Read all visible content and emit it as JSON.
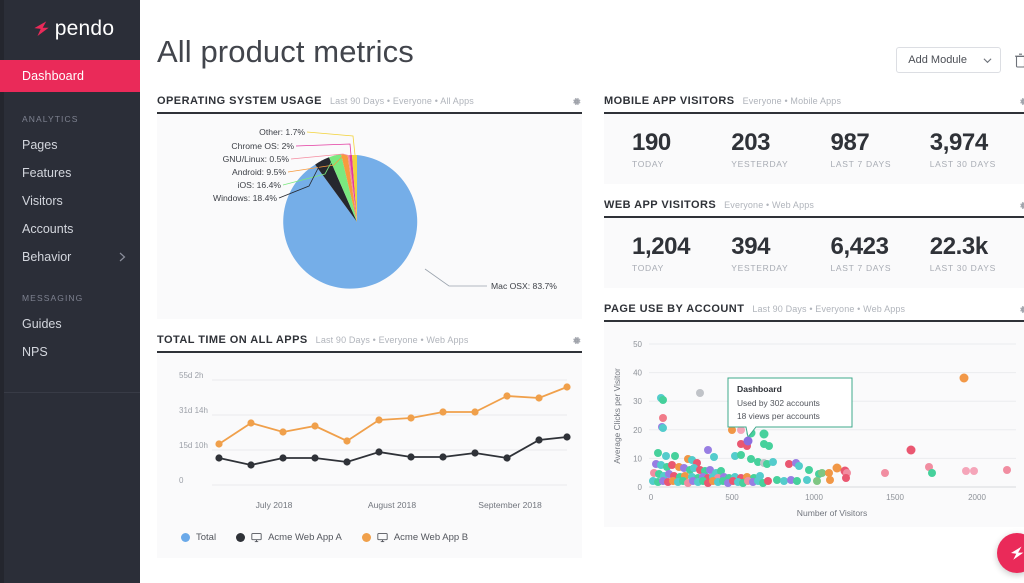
{
  "brand": {
    "name": "pendo",
    "logo_icon": "pendo-arrow-icon"
  },
  "sidebar": {
    "active_item": "Dashboard",
    "groups": [
      {
        "title": "ANALYTICS",
        "items": [
          {
            "label": "Pages",
            "chevron": false
          },
          {
            "label": "Features",
            "chevron": false
          },
          {
            "label": "Visitors",
            "chevron": false
          },
          {
            "label": "Accounts",
            "chevron": false
          },
          {
            "label": "Behavior",
            "chevron": true,
            "chevron_icon": "chevron-right-icon"
          }
        ]
      },
      {
        "title": "MESSAGING",
        "items": [
          {
            "label": "Guides",
            "chevron": false
          },
          {
            "label": "NPS",
            "chevron": false
          }
        ]
      }
    ]
  },
  "header": {
    "title": "All product metrics",
    "add_module_label": "Add Module",
    "add_module_icon": "chevron-down-icon",
    "delete_icon": "trash-icon"
  },
  "fab": {
    "icon": "pendo-arrow-icon",
    "color": "#ea2a59"
  },
  "modules": {
    "os_usage": {
      "title": "OPERATING SYSTEM USAGE",
      "subtitle": "Last 90 Days • Everyone • All Apps",
      "settings_icon": "gear-icon"
    },
    "mobile_visitors": {
      "title": "MOBILE APP VISITORS",
      "subtitle": "Everyone • Mobile Apps",
      "settings_icon": "gear-icon",
      "stats": [
        {
          "value": "190",
          "label": "TODAY"
        },
        {
          "value": "203",
          "label": "YESTERDAY"
        },
        {
          "value": "987",
          "label": "LAST 7 DAYS"
        },
        {
          "value": "3,974",
          "label": "LAST 30 DAYS"
        }
      ]
    },
    "web_visitors": {
      "title": "WEB APP VISITORS",
      "subtitle": "Everyone • Web Apps",
      "settings_icon": "gear-icon",
      "stats": [
        {
          "value": "1,204",
          "label": "TODAY"
        },
        {
          "value": "394",
          "label": "YESTERDAY"
        },
        {
          "value": "6,423",
          "label": "LAST 7 DAYS"
        },
        {
          "value": "22.3k",
          "label": "LAST 30 DAYS"
        }
      ]
    },
    "total_time": {
      "title": "TOTAL TIME ON ALL APPS",
      "subtitle": "Last 90 Days • Everyone • Web Apps",
      "settings_icon": "gear-icon",
      "legend": [
        {
          "label": "Total",
          "color": "#6aa9e9",
          "monitor": false
        },
        {
          "label": "Acme Web App A",
          "color": "#2f3238",
          "monitor": true,
          "monitor_icon": "monitor-icon"
        },
        {
          "label": "Acme Web App B",
          "color": "#f0a04b",
          "monitor": true,
          "monitor_icon": "monitor-icon"
        }
      ]
    },
    "page_use": {
      "title": "PAGE USE BY ACCOUNT",
      "subtitle": "Last 90 Days • Everyone • Web Apps",
      "settings_icon": "gear-icon",
      "tooltip": {
        "title": "Dashboard",
        "line1": "Used by 302 accounts",
        "line2": "18 views per accounts",
        "border_color": "#3fa98b"
      }
    }
  },
  "chart_data": [
    {
      "id": "os_usage_pie",
      "type": "pie",
      "title": "Operating System Usage",
      "legend": "labels-with-leader-lines",
      "slices": [
        {
          "label": "Mac OSX",
          "value": 83.7,
          "display": "Mac OSX: 83.7%",
          "color": "#75aee8"
        },
        {
          "label": "Windows",
          "value": 18.4,
          "display": "Windows: 18.4%",
          "color": "#26272e"
        },
        {
          "label": "iOS",
          "value": 16.4,
          "display": "iOS: 16.4%",
          "color": "#7ae87f"
        },
        {
          "label": "Android",
          "value": 9.5,
          "display": "Android: 9.5%",
          "color": "#f79b3e"
        },
        {
          "label": "GNU/Linux",
          "value": 0.5,
          "display": "GNU/Linux: 0.5%",
          "color": "#f58ca0"
        },
        {
          "label": "Chrome OS",
          "value": 2,
          "display": "Chrome OS: 2%",
          "color": "#e23aa0"
        },
        {
          "label": "Other",
          "value": 1.7,
          "display": "Other: 1.7%",
          "color": "#f2d23a"
        }
      ]
    },
    {
      "id": "total_time_line",
      "type": "line",
      "title": "Total Time on All Apps",
      "xlabel": "",
      "ylabel": "",
      "grid": true,
      "legend_position": "bottom",
      "y_ticks": [
        "0",
        "15d 10h",
        "31d 14h",
        "55d 2h"
      ],
      "y_tick_values": [
        0,
        15.42,
        31.58,
        55.08
      ],
      "ylim": [
        0,
        62
      ],
      "x_ticks": [
        "July 2018",
        "August 2018",
        "September 2018"
      ],
      "series": [
        {
          "name": "Acme Web App B",
          "color": "#f0a04b",
          "values": [
            16.5,
            27.5,
            23.5,
            26.0,
            18.0,
            29.5,
            30.5,
            33.0,
            33.0,
            40.0,
            39.5,
            44.5
          ]
        },
        {
          "name": "Acme Web App A",
          "color": "#2f3238",
          "values": [
            11.5,
            8.0,
            11.5,
            11.5,
            9.5,
            15.0,
            12.0,
            12.0,
            14.5,
            11.5,
            20.0,
            21.5
          ]
        },
        {
          "name": "Total",
          "color": "#6aa9e9",
          "values": []
        }
      ]
    },
    {
      "id": "page_use_scatter",
      "type": "scatter",
      "title": "Page Use by Account",
      "xlabel": "Number of Visitors",
      "ylabel": "Average Clicks per Visitor",
      "xlim": [
        0,
        2250
      ],
      "ylim": [
        0,
        52
      ],
      "x_ticks": [
        0,
        500,
        1000,
        1500,
        2000
      ],
      "y_ticks": [
        0,
        10,
        20,
        30,
        40,
        50
      ],
      "annotation": {
        "label": "Dashboard",
        "accounts": 302,
        "views_per_account": 18,
        "point": {
          "x": 840,
          "y": 14
        }
      },
      "points": [
        {
          "x": 60,
          "y": 31,
          "c": "#3ec6c6"
        },
        {
          "x": 70,
          "y": 30.5,
          "c": "#2ecc8f"
        },
        {
          "x": 300,
          "y": 33,
          "c": "#b9bcc2"
        },
        {
          "x": 75,
          "y": 24,
          "c": "#f06a7a"
        },
        {
          "x": 68,
          "y": 21,
          "c": "#8b6ee0"
        },
        {
          "x": 70,
          "y": 20.5,
          "c": "#3ec6c6"
        },
        {
          "x": 1920,
          "y": 38,
          "c": "#f08a2e"
        },
        {
          "x": 1590,
          "y": 13,
          "c": "#e8415e"
        },
        {
          "x": 1700,
          "y": 7,
          "c": "#f07f95"
        },
        {
          "x": 1720,
          "y": 5,
          "c": "#2ecc8f"
        },
        {
          "x": 1440,
          "y": 5,
          "c": "#f07f95"
        },
        {
          "x": 1930,
          "y": 5.5,
          "c": "#f59ab0"
        },
        {
          "x": 1980,
          "y": 5.5,
          "c": "#f59ab0"
        },
        {
          "x": 2180,
          "y": 6,
          "c": "#f07f95"
        },
        {
          "x": 500,
          "y": 20,
          "c": "#f08a2e"
        },
        {
          "x": 560,
          "y": 20,
          "c": "#f59ab0"
        },
        {
          "x": 620,
          "y": 19,
          "c": "#2ecc8f"
        },
        {
          "x": 700,
          "y": 18.5,
          "c": "#2ecc8f"
        },
        {
          "x": 560,
          "y": 15,
          "c": "#e8415e"
        },
        {
          "x": 600,
          "y": 14.5,
          "c": "#e8415e"
        },
        {
          "x": 700,
          "y": 15,
          "c": "#2ecc8f"
        },
        {
          "x": 730,
          "y": 14.5,
          "c": "#2ecc8f"
        },
        {
          "x": 350,
          "y": 13,
          "c": "#8b6ee0"
        },
        {
          "x": 390,
          "y": 10.5,
          "c": "#3ec6c6"
        },
        {
          "x": 520,
          "y": 11,
          "c": "#3ec6c6"
        },
        {
          "x": 560,
          "y": 11.5,
          "c": "#2ecc8f"
        },
        {
          "x": 620,
          "y": 10,
          "c": "#2ecc8f"
        },
        {
          "x": 660,
          "y": 9,
          "c": "#2ecc8f"
        },
        {
          "x": 700,
          "y": 8.5,
          "c": "#b9bcc2"
        },
        {
          "x": 720,
          "y": 8,
          "c": "#2ecc8f"
        },
        {
          "x": 760,
          "y": 9,
          "c": "#3ec6c6"
        },
        {
          "x": 860,
          "y": 8,
          "c": "#e8415e"
        },
        {
          "x": 900,
          "y": 8.5,
          "c": "#8b6ee0"
        },
        {
          "x": 920,
          "y": 7.5,
          "c": "#3ec6c6"
        },
        {
          "x": 980,
          "y": 6,
          "c": "#2ecc8f"
        },
        {
          "x": 1040,
          "y": 4.5,
          "c": "#2ecc8f"
        },
        {
          "x": 1060,
          "y": 5,
          "c": "#6fbf73"
        },
        {
          "x": 1100,
          "y": 5,
          "c": "#f08a2e"
        },
        {
          "x": 1150,
          "y": 6.5,
          "c": "#f08a2e"
        },
        {
          "x": 1200,
          "y": 5.5,
          "c": "#e8415e"
        },
        {
          "x": 1210,
          "y": 5,
          "c": "#f07f95"
        },
        {
          "x": 40,
          "y": 12,
          "c": "#2ecc8f"
        },
        {
          "x": 90,
          "y": 11,
          "c": "#3ec6c6"
        },
        {
          "x": 150,
          "y": 11,
          "c": "#2ecc8f"
        },
        {
          "x": 230,
          "y": 10,
          "c": "#f08a2e"
        },
        {
          "x": 250,
          "y": 9.5,
          "c": "#3ec6c6"
        },
        {
          "x": 280,
          "y": 8.5,
          "c": "#e8415e"
        },
        {
          "x": 30,
          "y": 8,
          "c": "#8b6ee0"
        },
        {
          "x": 60,
          "y": 7.5,
          "c": "#3ec6c6"
        },
        {
          "x": 100,
          "y": 7,
          "c": "#2ecc8f"
        },
        {
          "x": 130,
          "y": 7.5,
          "c": "#e8415e"
        },
        {
          "x": 170,
          "y": 7,
          "c": "#f08a2e"
        },
        {
          "x": 200,
          "y": 6.5,
          "c": "#8b6ee0"
        },
        {
          "x": 240,
          "y": 6,
          "c": "#2ecc8f"
        },
        {
          "x": 270,
          "y": 6.5,
          "c": "#3ec6c6"
        },
        {
          "x": 300,
          "y": 6,
          "c": "#e8415e"
        },
        {
          "x": 330,
          "y": 5.5,
          "c": "#2ecc8f"
        },
        {
          "x": 360,
          "y": 6,
          "c": "#8b6ee0"
        },
        {
          "x": 400,
          "y": 5,
          "c": "#3ec6c6"
        },
        {
          "x": 430,
          "y": 5.5,
          "c": "#2ecc8f"
        },
        {
          "x": 20,
          "y": 5,
          "c": "#f07f95"
        },
        {
          "x": 50,
          "y": 4.5,
          "c": "#2ecc8f"
        },
        {
          "x": 80,
          "y": 4,
          "c": "#3ec6c6"
        },
        {
          "x": 110,
          "y": 4.5,
          "c": "#8b6ee0"
        },
        {
          "x": 140,
          "y": 4,
          "c": "#e8415e"
        },
        {
          "x": 180,
          "y": 3.5,
          "c": "#2ecc8f"
        },
        {
          "x": 210,
          "y": 4,
          "c": "#f08a2e"
        },
        {
          "x": 250,
          "y": 3.5,
          "c": "#3ec6c6"
        },
        {
          "x": 290,
          "y": 3,
          "c": "#2ecc8f"
        },
        {
          "x": 320,
          "y": 3.5,
          "c": "#8b6ee0"
        },
        {
          "x": 350,
          "y": 3,
          "c": "#e8415e"
        },
        {
          "x": 380,
          "y": 3.5,
          "c": "#3ec6c6"
        },
        {
          "x": 410,
          "y": 3,
          "c": "#f07f95"
        },
        {
          "x": 450,
          "y": 3.5,
          "c": "#8b6ee0"
        },
        {
          "x": 480,
          "y": 3,
          "c": "#2ecc8f"
        },
        {
          "x": 520,
          "y": 3.5,
          "c": "#3ec6c6"
        },
        {
          "x": 560,
          "y": 3,
          "c": "#e8415e"
        },
        {
          "x": 600,
          "y": 3.5,
          "c": "#f08a2e"
        },
        {
          "x": 640,
          "y": 3,
          "c": "#2ecc8f"
        },
        {
          "x": 680,
          "y": 4,
          "c": "#3ec6c6"
        },
        {
          "x": 15,
          "y": 2,
          "c": "#3ec6c6"
        },
        {
          "x": 45,
          "y": 1.8,
          "c": "#2ecc8f"
        },
        {
          "x": 75,
          "y": 2.2,
          "c": "#8b6ee0"
        },
        {
          "x": 105,
          "y": 1.6,
          "c": "#e8415e"
        },
        {
          "x": 135,
          "y": 2,
          "c": "#f08a2e"
        },
        {
          "x": 165,
          "y": 1.8,
          "c": "#3ec6c6"
        },
        {
          "x": 195,
          "y": 2.2,
          "c": "#2ecc8f"
        },
        {
          "x": 225,
          "y": 1.5,
          "c": "#f07f95"
        },
        {
          "x": 255,
          "y": 2,
          "c": "#8b6ee0"
        },
        {
          "x": 285,
          "y": 1.8,
          "c": "#3ec6c6"
        },
        {
          "x": 315,
          "y": 2.2,
          "c": "#2ecc8f"
        },
        {
          "x": 345,
          "y": 1.6,
          "c": "#e8415e"
        },
        {
          "x": 375,
          "y": 2,
          "c": "#f08a2e"
        },
        {
          "x": 405,
          "y": 1.8,
          "c": "#3ec6c6"
        },
        {
          "x": 435,
          "y": 2.2,
          "c": "#2ecc8f"
        },
        {
          "x": 465,
          "y": 1.5,
          "c": "#8b6ee0"
        },
        {
          "x": 495,
          "y": 2,
          "c": "#e8415e"
        },
        {
          "x": 525,
          "y": 1.8,
          "c": "#3ec6c6"
        },
        {
          "x": 555,
          "y": 1.6,
          "c": "#2ecc8f"
        },
        {
          "x": 585,
          "y": 2,
          "c": "#f07f95"
        },
        {
          "x": 615,
          "y": 1.8,
          "c": "#8b6ee0"
        },
        {
          "x": 645,
          "y": 2.2,
          "c": "#3ec6c6"
        },
        {
          "x": 675,
          "y": 1.5,
          "c": "#2ecc8f"
        },
        {
          "x": 705,
          "y": 2,
          "c": "#e8415e"
        },
        {
          "x": 760,
          "y": 2.5,
          "c": "#2ecc8f"
        },
        {
          "x": 800,
          "y": 2,
          "c": "#3ec6c6"
        },
        {
          "x": 840,
          "y": 2.5,
          "c": "#8b6ee0"
        },
        {
          "x": 880,
          "y": 2,
          "c": "#2ecc8f"
        },
        {
          "x": 940,
          "y": 2.5,
          "c": "#3ec6c6"
        },
        {
          "x": 1000,
          "y": 2,
          "c": "#6fbf73"
        },
        {
          "x": 1080,
          "y": 2.5,
          "c": "#f08a2e"
        },
        {
          "x": 1180,
          "y": 3,
          "c": "#e8415e"
        }
      ]
    }
  ]
}
